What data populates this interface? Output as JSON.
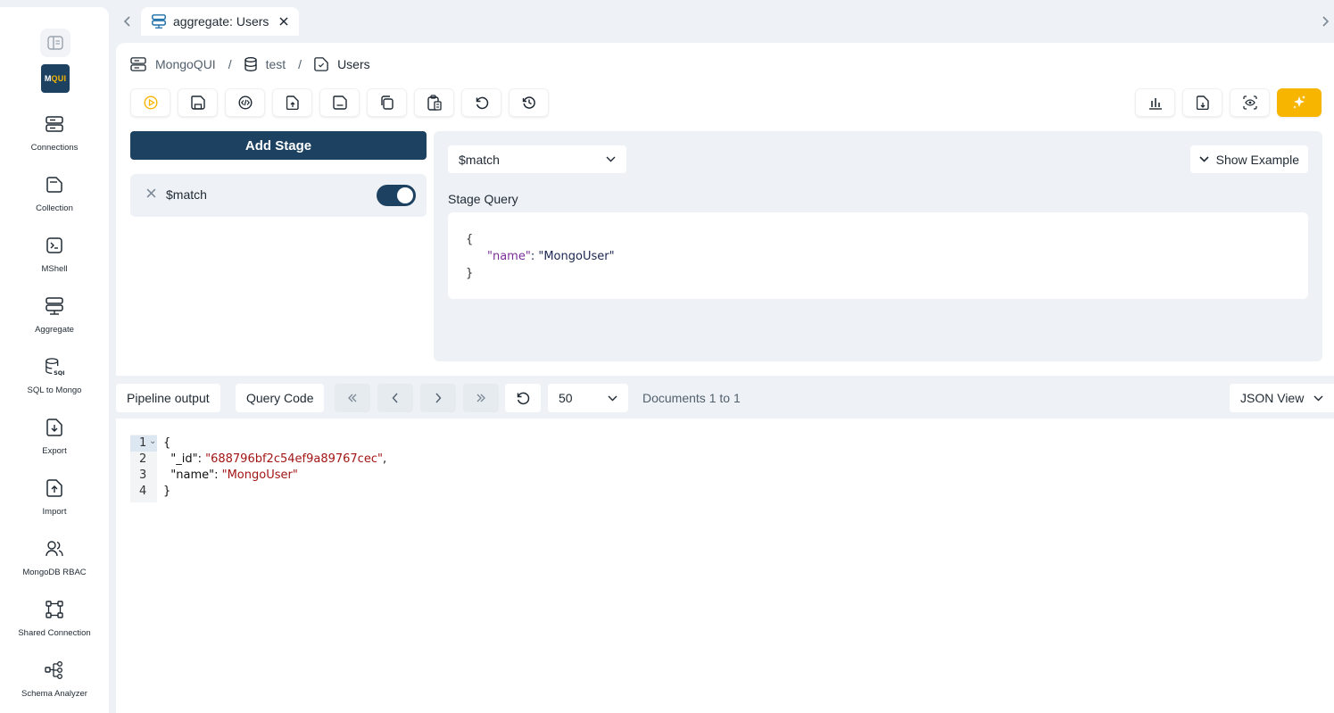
{
  "sidebar": {
    "logo": {
      "m": "M",
      "q": "QUI"
    },
    "items": [
      {
        "label": "Connections",
        "icon": "server-icon"
      },
      {
        "label": "Collection",
        "icon": "folder-icon"
      },
      {
        "label": "MShell",
        "icon": "terminal-icon"
      },
      {
        "label": "Aggregate",
        "icon": "aggregate-icon"
      },
      {
        "label": "SQL to Mongo",
        "icon": "database-sql-icon"
      },
      {
        "label": "Export",
        "icon": "export-icon"
      },
      {
        "label": "Import",
        "icon": "import-icon"
      },
      {
        "label": "MongoDB RBAC",
        "icon": "users-icon"
      },
      {
        "label": "Shared Connection",
        "icon": "share-nodes-icon"
      },
      {
        "label": "Schema Analyzer",
        "icon": "schema-icon"
      }
    ]
  },
  "tabs": [
    {
      "label": "aggregate: Users",
      "active": true
    }
  ],
  "breadcrumb": {
    "connection": "MongoQUI",
    "database": "test",
    "collection": "Users",
    "separator": "/"
  },
  "pipeline": {
    "add_stage_label": "Add Stage",
    "stages": [
      {
        "name": "$match",
        "enabled": true
      }
    ]
  },
  "stage_editor": {
    "selected_operator": "$match",
    "show_example_label": "Show Example",
    "stage_query_label": "Stage Query",
    "query_lines": {
      "open": "{",
      "key": "\"name\"",
      "colon": ": ",
      "value": "\"MongoUser\"",
      "close": "}"
    }
  },
  "results": {
    "pipeline_output_label": "Pipeline output",
    "query_code_label": "Query Code",
    "page_size": "50",
    "documents_label": "Documents 1 to 1",
    "view_mode": "JSON View"
  },
  "output": {
    "lines": [
      {
        "num": "1",
        "text": "{"
      },
      {
        "num": "2",
        "key": "  \"_id\": ",
        "value": "\"688796bf2c54ef9a89767cec\"",
        "tail": ","
      },
      {
        "num": "3",
        "key": "  \"name\": ",
        "value": "\"MongoUser\"",
        "tail": ""
      },
      {
        "num": "4",
        "text": "}"
      }
    ]
  },
  "colors": {
    "primary": "#1d4160",
    "accent": "#f7b500",
    "background": "#eef2f6"
  }
}
